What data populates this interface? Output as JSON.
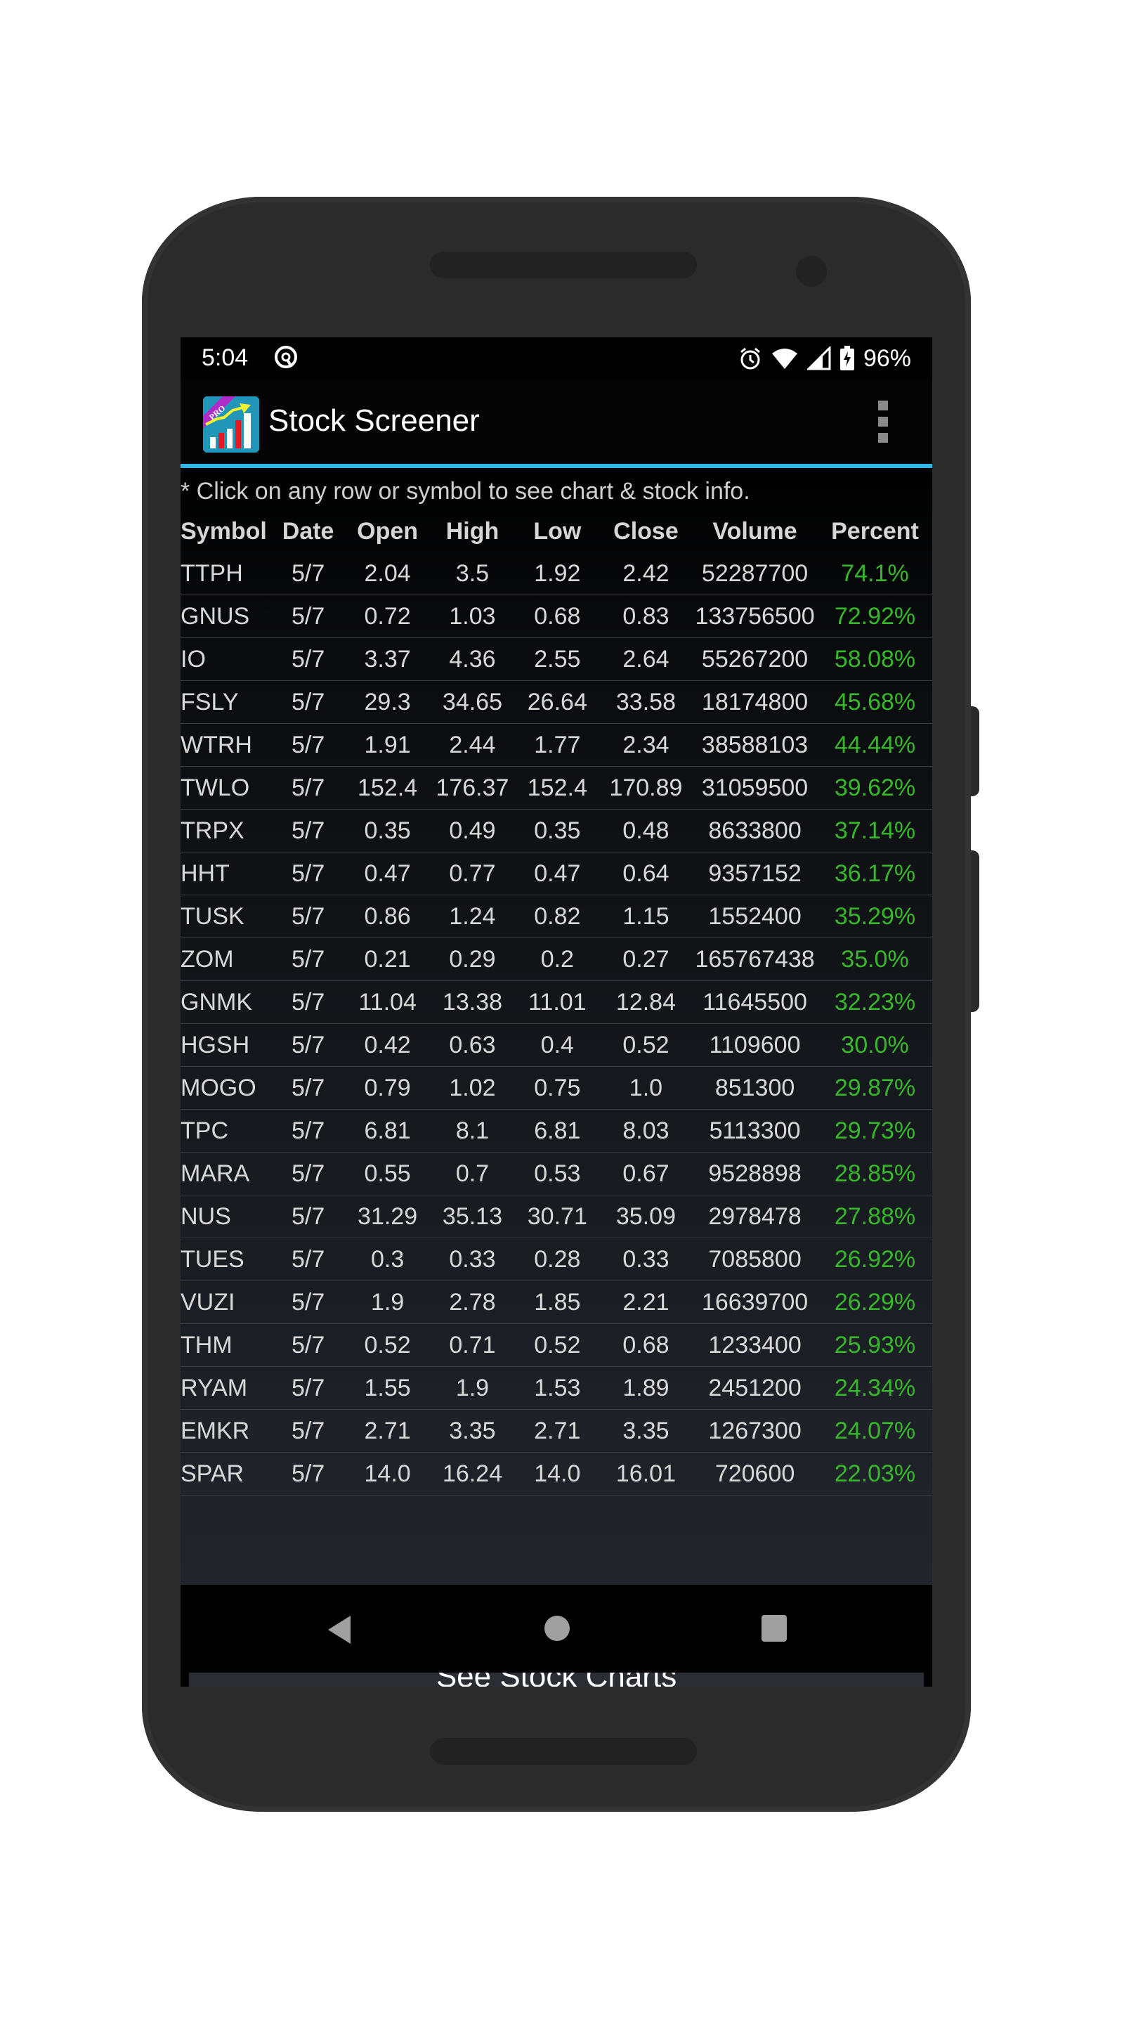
{
  "status_bar": {
    "time": "5:04",
    "icons": [
      "do-not-disturb-icon",
      "alarm-icon",
      "wifi-icon",
      "cellular-signal-icon",
      "battery-charging-icon"
    ],
    "battery_percent": "96%"
  },
  "app_bar": {
    "title": "Stock Screener",
    "logo_badge": "PRO",
    "menu_icon": "overflow-menu-icon"
  },
  "hint": "* Click on any row or symbol to see chart & stock info.",
  "table": {
    "columns": [
      "Symbol",
      "Date",
      "Open",
      "High",
      "Low",
      "Close",
      "Volume",
      "Percent"
    ],
    "rows": [
      [
        "TTPH",
        "5/7",
        "2.04",
        "3.5",
        "1.92",
        "2.42",
        "52287700",
        "74.1%"
      ],
      [
        "GNUS",
        "5/7",
        "0.72",
        "1.03",
        "0.68",
        "0.83",
        "133756500",
        "72.92%"
      ],
      [
        "IO",
        "5/7",
        "3.37",
        "4.36",
        "2.55",
        "2.64",
        "55267200",
        "58.08%"
      ],
      [
        "FSLY",
        "5/7",
        "29.3",
        "34.65",
        "26.64",
        "33.58",
        "18174800",
        "45.68%"
      ],
      [
        "WTRH",
        "5/7",
        "1.91",
        "2.44",
        "1.77",
        "2.34",
        "38588103",
        "44.44%"
      ],
      [
        "TWLO",
        "5/7",
        "152.4",
        "176.37",
        "152.4",
        "170.89",
        "31059500",
        "39.62%"
      ],
      [
        "TRPX",
        "5/7",
        "0.35",
        "0.49",
        "0.35",
        "0.48",
        "8633800",
        "37.14%"
      ],
      [
        "HHT",
        "5/7",
        "0.47",
        "0.77",
        "0.47",
        "0.64",
        "9357152",
        "36.17%"
      ],
      [
        "TUSK",
        "5/7",
        "0.86",
        "1.24",
        "0.82",
        "1.15",
        "1552400",
        "35.29%"
      ],
      [
        "ZOM",
        "5/7",
        "0.21",
        "0.29",
        "0.2",
        "0.27",
        "165767438",
        "35.0%"
      ],
      [
        "GNMK",
        "5/7",
        "11.04",
        "13.38",
        "11.01",
        "12.84",
        "11645500",
        "32.23%"
      ],
      [
        "HGSH",
        "5/7",
        "0.42",
        "0.63",
        "0.4",
        "0.52",
        "1109600",
        "30.0%"
      ],
      [
        "MOGO",
        "5/7",
        "0.79",
        "1.02",
        "0.75",
        "1.0",
        "851300",
        "29.87%"
      ],
      [
        "TPC",
        "5/7",
        "6.81",
        "8.1",
        "6.81",
        "8.03",
        "5113300",
        "29.73%"
      ],
      [
        "MARA",
        "5/7",
        "0.55",
        "0.7",
        "0.53",
        "0.67",
        "9528898",
        "28.85%"
      ],
      [
        "NUS",
        "5/7",
        "31.29",
        "35.13",
        "30.71",
        "35.09",
        "2978478",
        "27.88%"
      ],
      [
        "TUES",
        "5/7",
        "0.3",
        "0.33",
        "0.28",
        "0.33",
        "7085800",
        "26.92%"
      ],
      [
        "VUZI",
        "5/7",
        "1.9",
        "2.78",
        "1.85",
        "2.21",
        "16639700",
        "26.29%"
      ],
      [
        "THM",
        "5/7",
        "0.52",
        "0.71",
        "0.52",
        "0.68",
        "1233400",
        "25.93%"
      ],
      [
        "RYAM",
        "5/7",
        "1.55",
        "1.9",
        "1.53",
        "1.89",
        "2451200",
        "24.34%"
      ],
      [
        "EMKR",
        "5/7",
        "2.71",
        "3.35",
        "2.71",
        "3.35",
        "1267300",
        "24.07%"
      ],
      [
        "SPAR",
        "5/7",
        "14.0",
        "16.24",
        "14.0",
        "16.01",
        "720600",
        "22.03%"
      ]
    ]
  },
  "button": {
    "label": "See Stock Charts"
  },
  "nav_bar": {
    "icons": [
      "back-icon",
      "home-icon",
      "recents-icon"
    ]
  },
  "colors": {
    "accent": "#33b5e5",
    "percent_positive": "#36b82a",
    "app_bar_bg": "#050505",
    "button_bg": "#2a2e34"
  }
}
